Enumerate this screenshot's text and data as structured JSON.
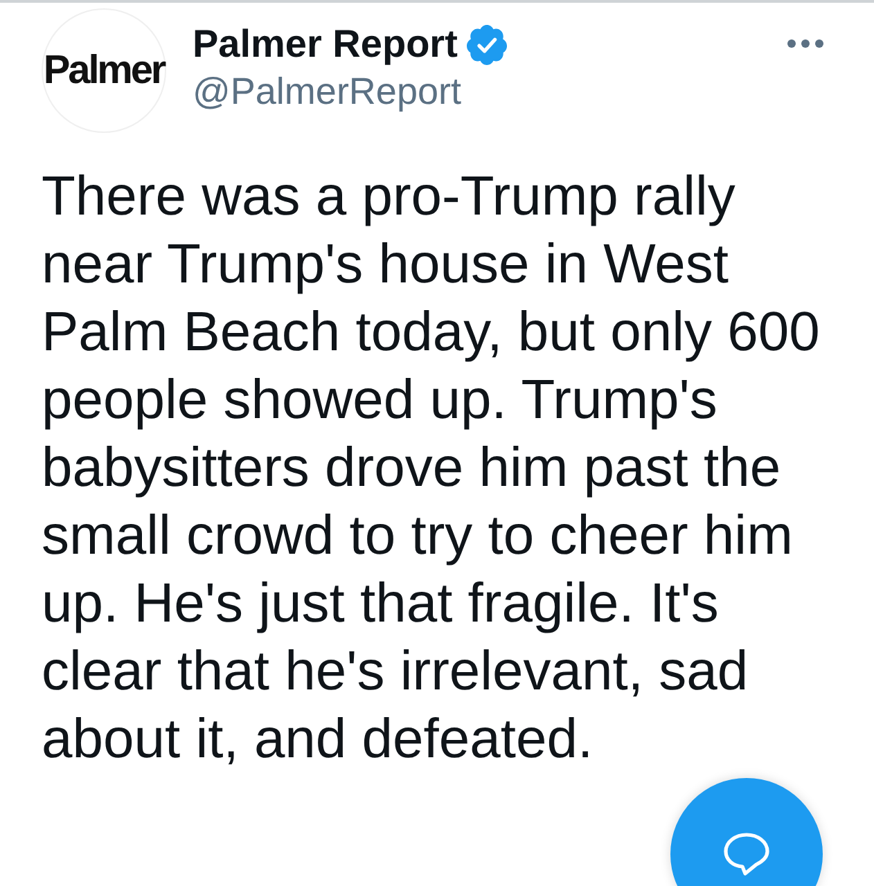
{
  "tweet": {
    "avatar": {
      "logo_text": "Palmer"
    },
    "author": {
      "name": "Palmer Report",
      "verified": true,
      "handle": "@PalmerReport"
    },
    "text": "There was a pro-Trump rally near Trump's house in West Palm Beach today, but only 600 people showed up. Trump's babysitters drove him past the small crowd to try to cheer him up. He's just that fragile. It's clear that he's irrelevant, sad about it, and defeated."
  }
}
